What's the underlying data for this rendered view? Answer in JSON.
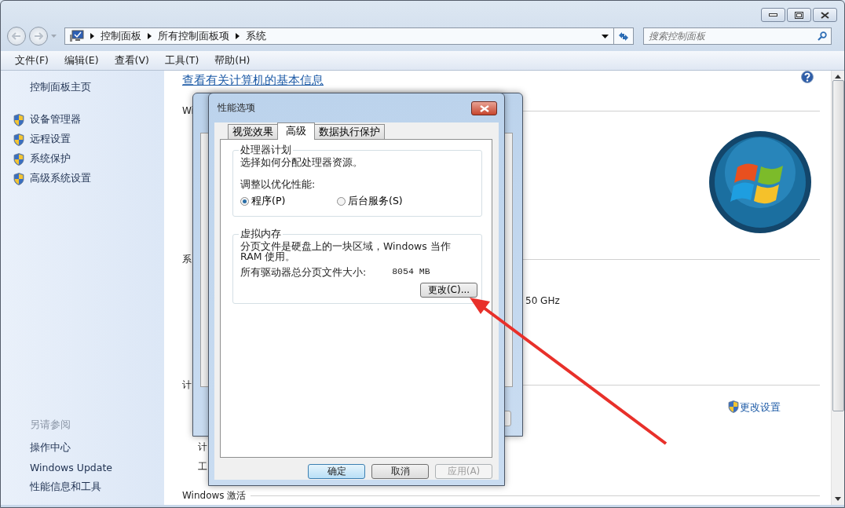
{
  "address_bar": {
    "breadcrumbs": [
      "控制面板",
      "所有控制面板项",
      "系统"
    ]
  },
  "search": {
    "placeholder": "搜索控制面板"
  },
  "menu": [
    "文件(F)",
    "编辑(E)",
    "查看(V)",
    "工具(T)",
    "帮助(H)"
  ],
  "sidebar": {
    "home": "控制面板主页",
    "tasks": [
      "设备管理器",
      "远程设置",
      "系统保护",
      "高级系统设置"
    ],
    "see_also_title": "另请参阅",
    "see_also": [
      "操作中心",
      "Windows Update",
      "性能信息和工具"
    ]
  },
  "content": {
    "heading": "查看有关计算机的基本信息",
    "section_1": "Wi",
    "section_2": "系",
    "processor_speed": "50 GHz",
    "section_3": "计",
    "change_settings": "更改设置",
    "row_1": "计",
    "row_2": "工",
    "section_4": "Windows 激活"
  },
  "dialog": {
    "title": "性能选项",
    "tabs": [
      {
        "label": "视觉效果",
        "selected": false
      },
      {
        "label": "高级",
        "selected": true
      },
      {
        "label": "数据执行保护",
        "selected": false
      }
    ],
    "processor_group": {
      "title": "处理器计划",
      "description": "选择如何分配处理器资源。",
      "prompt": "调整以优化性能:",
      "options": [
        {
          "label": "程序(P)",
          "selected": true
        },
        {
          "label": "后台服务(S)",
          "selected": false
        }
      ]
    },
    "memory_group": {
      "title": "虚拟内存",
      "description": "分页文件是硬盘上的一块区域，Windows 当作 RAM 使用。",
      "total_label": "所有驱动器总分页文件大小:",
      "total_value": "8054 MB",
      "change_button": "更改(C)..."
    },
    "buttons": [
      {
        "label": "确定",
        "kind": "default"
      },
      {
        "label": "取消",
        "kind": "normal"
      },
      {
        "label": "应用(A)",
        "kind": "disabled"
      }
    ]
  }
}
